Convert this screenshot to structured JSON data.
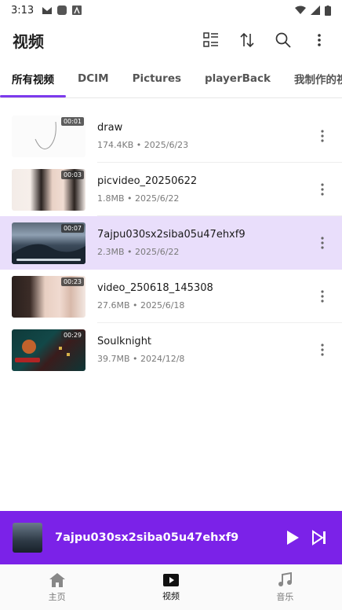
{
  "status": {
    "time": "3:13"
  },
  "app": {
    "title": "视频"
  },
  "tabs": [
    {
      "label": "所有视频",
      "active": true
    },
    {
      "label": "DCIM"
    },
    {
      "label": "Pictures"
    },
    {
      "label": "playerBack"
    },
    {
      "label": "我制作的视频"
    }
  ],
  "videos": [
    {
      "name": "draw",
      "size": "174.4KB",
      "date": "2025/6/23",
      "duration": "00:01"
    },
    {
      "name": "picvideo_20250622",
      "size": "1.8MB",
      "date": "2025/6/22",
      "duration": "00:03"
    },
    {
      "name": "7ajpu030sx2siba05u47ehxf9",
      "size": "2.3MB",
      "date": "2025/6/22",
      "duration": "00:07",
      "selected": true
    },
    {
      "name": "video_250618_145308",
      "size": "27.6MB",
      "date": "2025/6/18",
      "duration": "00:23"
    },
    {
      "name": "Soulknight",
      "size": "39.7MB",
      "date": "2024/12/8",
      "duration": "00:29"
    }
  ],
  "info_separator": "•",
  "player": {
    "title": "7ajpu030sx2siba05u47ehxf9"
  },
  "nav": [
    {
      "label": "主页",
      "icon": "home-icon"
    },
    {
      "label": "视频",
      "icon": "video-icon",
      "active": true
    },
    {
      "label": "音乐",
      "icon": "music-icon"
    }
  ],
  "colors": {
    "accent": "#7b22e8",
    "selected_row": "#e9defb",
    "tab_indicator": "#7c3aed"
  }
}
